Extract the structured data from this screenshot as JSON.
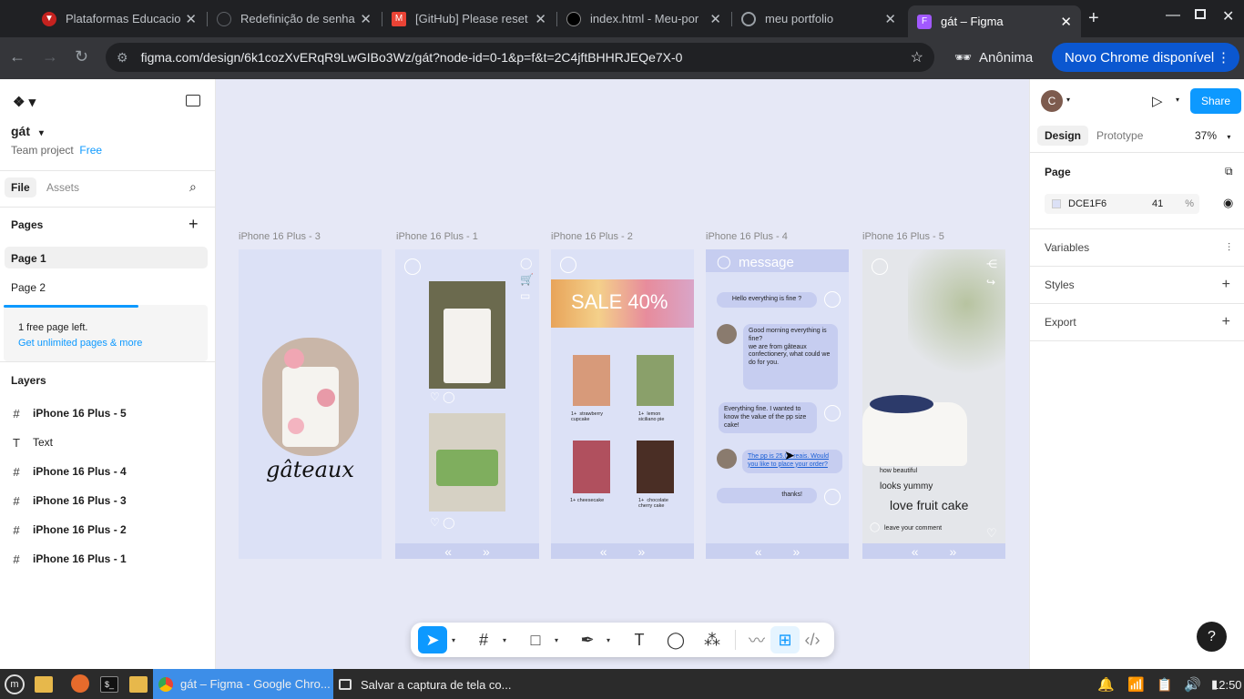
{
  "browser": {
    "tabs": [
      {
        "title": "Plataformas Educacio",
        "color": "#c5221f"
      },
      {
        "title": "Redefinição de senha",
        "color": "#444"
      },
      {
        "title": "[GitHub] Please reset",
        "color": "#ea4335"
      },
      {
        "title": "index.html - Meu-por",
        "color": "#444"
      },
      {
        "title": "meu portfolio",
        "color": "#666"
      },
      {
        "title": "gát – Figma",
        "color": "#a259ff"
      }
    ],
    "url": "figma.com/design/6k1cozXvERqR9LwGIBo3Wz/gát?node-id=0-1&p=f&t=2C4jftBHHRJEQe7X-0",
    "incognito": "Anônima",
    "update": "Novo Chrome disponível"
  },
  "left": {
    "file_name": "gát",
    "team": "Team project",
    "plan": "Free",
    "tab_file": "File",
    "tab_assets": "Assets",
    "pages_title": "Pages",
    "pages": [
      "Page 1",
      "Page 2"
    ],
    "notice": "1 free page left.",
    "notice_link": "Get unlimited pages & more",
    "layers_title": "Layers",
    "layers": [
      {
        "icon": "#",
        "name": "iPhone 16 Plus - 5"
      },
      {
        "icon": "T",
        "name": "Text"
      },
      {
        "icon": "#",
        "name": "iPhone 16 Plus - 4"
      },
      {
        "icon": "#",
        "name": "iPhone 16 Plus - 3"
      },
      {
        "icon": "#",
        "name": "iPhone 16 Plus - 2"
      },
      {
        "icon": "#",
        "name": "iPhone 16 Plus - 1"
      }
    ]
  },
  "right": {
    "avatar": "C",
    "share": "Share",
    "tab_design": "Design",
    "tab_prototype": "Prototype",
    "zoom": "37%",
    "page_title": "Page",
    "color_hex": "DCE1F6",
    "opacity": "41",
    "pct": "%",
    "sections": [
      "Variables",
      "Styles",
      "Export"
    ]
  },
  "canvas": {
    "frames": [
      "iPhone 16 Plus - 3",
      "iPhone 16 Plus - 1",
      "iPhone 16 Plus - 2",
      "iPhone 16 Plus - 4",
      "iPhone 16 Plus - 5"
    ],
    "logo": "gâteaux",
    "sale": "SALE 40%",
    "products": [
      "strawberry cupcake",
      "lemon siciliano pie",
      "cheesecake",
      "chocolate cherry cake"
    ],
    "product_qty": "1+",
    "message_title": "message",
    "chat": [
      "Hello everything is fine ?",
      "Good morning everything is fine?\nwe are from gâteaux confectionery, what could we do for you.",
      "Everything fine. I wanted to know the value of the pp size cake!",
      "The pp is 25.00 reais. Would you like to place your order?",
      "thanks!"
    ],
    "comments": [
      "how beautiful",
      "looks yummy",
      "love fruit cake"
    ],
    "comment_placeholder": "leave your comment",
    "nav_prev": "«",
    "nav_next": "»"
  },
  "taskbar": {
    "chrome_title": "gát – Figma - Google Chro...",
    "screenshot_title": "Salvar a captura de tela co...",
    "time": "12:50"
  }
}
